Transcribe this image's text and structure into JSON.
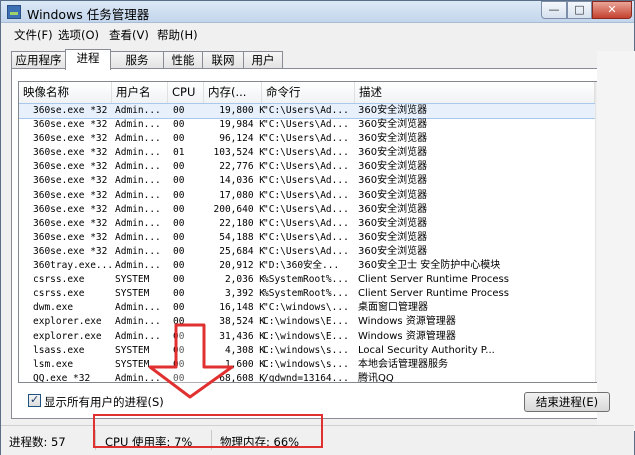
{
  "window": {
    "title": "Windows 任务管理器",
    "min_label": "—",
    "max_label": "□",
    "close_label": "✕"
  },
  "menu": [
    "文件(F)",
    "选项(O)",
    "查看(V)",
    "帮助(H)"
  ],
  "tabs": [
    "应用程序",
    "进程",
    "服务",
    "性能",
    "联网",
    "用户"
  ],
  "active_tab": "进程",
  "columns": [
    "映像名称",
    "用户名",
    "CPU",
    "内存(...",
    "命令行",
    "描述"
  ],
  "rows": [
    {
      "name": "360se.exe *32",
      "user": "Admin...",
      "cpu": "00",
      "mem": "19,800 K",
      "cmd": "\"C:\\Users\\Ad...",
      "desc": "360安全浏览器",
      "selected": true
    },
    {
      "name": "360se.exe *32",
      "user": "Admin...",
      "cpu": "00",
      "mem": "19,984 K",
      "cmd": "\"C:\\Users\\Ad...",
      "desc": "360安全浏览器"
    },
    {
      "name": "360se.exe *32",
      "user": "Admin...",
      "cpu": "00",
      "mem": "96,124 K",
      "cmd": "\"C:\\Users\\Ad...",
      "desc": "360安全浏览器"
    },
    {
      "name": "360se.exe *32",
      "user": "Admin...",
      "cpu": "01",
      "mem": "103,524 K",
      "cmd": "\"C:\\Users\\Ad...",
      "desc": "360安全浏览器"
    },
    {
      "name": "360se.exe *32",
      "user": "Admin...",
      "cpu": "00",
      "mem": "22,776 K",
      "cmd": "\"C:\\Users\\Ad...",
      "desc": "360安全浏览器"
    },
    {
      "name": "360se.exe *32",
      "user": "Admin...",
      "cpu": "00",
      "mem": "14,036 K",
      "cmd": "\"C:\\Users\\Ad...",
      "desc": "360安全浏览器"
    },
    {
      "name": "360se.exe *32",
      "user": "Admin...",
      "cpu": "00",
      "mem": "17,080 K",
      "cmd": "\"C:\\Users\\Ad...",
      "desc": "360安全浏览器"
    },
    {
      "name": "360se.exe *32",
      "user": "Admin...",
      "cpu": "00",
      "mem": "200,640 K",
      "cmd": "\"C:\\Users\\Ad...",
      "desc": "360安全浏览器"
    },
    {
      "name": "360se.exe *32",
      "user": "Admin...",
      "cpu": "00",
      "mem": "22,180 K",
      "cmd": "\"C:\\Users\\Ad...",
      "desc": "360安全浏览器"
    },
    {
      "name": "360se.exe *32",
      "user": "Admin...",
      "cpu": "00",
      "mem": "54,188 K",
      "cmd": "\"C:\\Users\\Ad...",
      "desc": "360安全浏览器"
    },
    {
      "name": "360se.exe *32",
      "user": "Admin...",
      "cpu": "00",
      "mem": "25,684 K",
      "cmd": "\"C:\\Users\\Ad...",
      "desc": "360安全浏览器"
    },
    {
      "name": "360tray.exe...",
      "user": "Admin...",
      "cpu": "00",
      "mem": "20,912 K",
      "cmd": "\"D:\\360安全...",
      "desc": "360安全卫士 安全防护中心模块"
    },
    {
      "name": "csrss.exe",
      "user": "SYSTEM",
      "cpu": "00",
      "mem": "2,036 K",
      "cmd": "%SystemRoot%...",
      "desc": "Client Server Runtime Process"
    },
    {
      "name": "csrss.exe",
      "user": "SYSTEM",
      "cpu": "00",
      "mem": "3,392 K",
      "cmd": "%SystemRoot%...",
      "desc": "Client Server Runtime Process"
    },
    {
      "name": "dwm.exe",
      "user": "Admin...",
      "cpu": "00",
      "mem": "16,148 K",
      "cmd": "\"C:\\windows\\...",
      "desc": "桌面窗口管理器"
    },
    {
      "name": "explorer.exe",
      "user": "Admin...",
      "cpu": "00",
      "mem": "38,524 K",
      "cmd": "C:\\windows\\E...",
      "desc": "Windows 资源管理器"
    },
    {
      "name": "explorer.exe",
      "user": "Admin...",
      "cpu": "00",
      "mem": "31,436 K",
      "cmd": "C:\\windows\\E...",
      "desc": "Windows 资源管理器"
    },
    {
      "name": "lsass.exe",
      "user": "SYSTEM",
      "cpu": "00",
      "mem": "4,308 K",
      "cmd": "C:\\windows\\s...",
      "desc": "Local Security Authority P..."
    },
    {
      "name": "lsm.exe",
      "user": "SYSTEM",
      "cpu": "00",
      "mem": "1,600 K",
      "cmd": "C:\\windows\\s...",
      "desc": "本地会话管理器服务"
    },
    {
      "name": "QQ.exe *32",
      "user": "Admin...",
      "cpu": "00",
      "mem": "68,608 K",
      "cmd": "/qdwnd=13164...",
      "desc": "腾讯QQ"
    }
  ],
  "show_all_users": {
    "label": "显示所有用户的进程(S)",
    "checked": true
  },
  "end_process_label": "结束进程(E)",
  "status": {
    "processes": "进程数: 57",
    "cpu": "CPU 使用率: 7%",
    "memory": "物理内存: 66%"
  },
  "colors": {
    "highlight_box": "#e03030",
    "arrow": "#e03030",
    "selected_row": "#e8f1fb"
  }
}
